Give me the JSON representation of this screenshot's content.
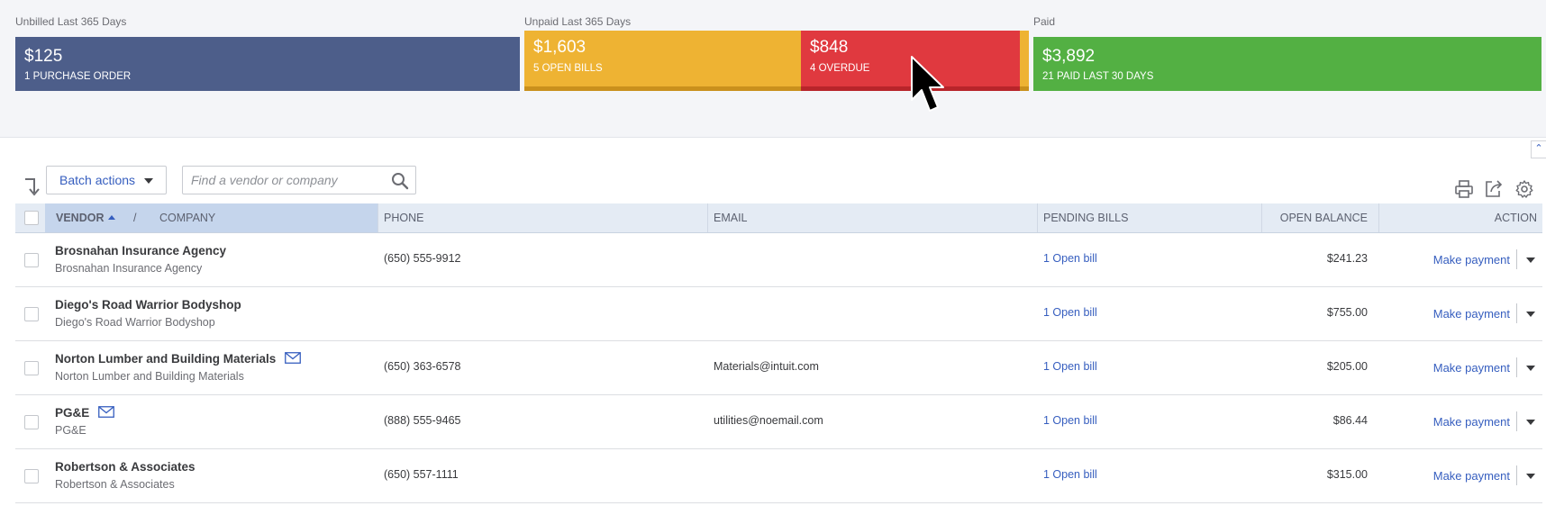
{
  "money_bar": {
    "unbilled": {
      "label": "Unbilled Last 365 Days",
      "amount": "$125",
      "sub": "1 PURCHASE ORDER"
    },
    "unpaid": {
      "label": "Unpaid Last 365 Days",
      "open": {
        "amount": "$1,603",
        "sub": "5 OPEN BILLS"
      },
      "overdue": {
        "amount": "$848",
        "sub": "4 OVERDUE"
      }
    },
    "paid": {
      "label": "Paid",
      "amount": "$3,892",
      "sub": "21 PAID LAST 30 DAYS"
    },
    "colors": {
      "unbilled": "#4d5e8a",
      "open": "#eeb333",
      "overdue": "#e0393f",
      "paid": "#53b043"
    }
  },
  "toolbar": {
    "batch_actions_label": "Batch actions",
    "search_placeholder": "Find a vendor or company"
  },
  "table": {
    "headers": {
      "vendor": "VENDOR",
      "slash": "/",
      "company": "COMPANY",
      "phone": "PHONE",
      "email": "EMAIL",
      "pending_bills": "PENDING BILLS",
      "open_balance": "OPEN BALANCE",
      "action": "ACTION"
    },
    "rows": [
      {
        "vendor": "Brosnahan Insurance Agency",
        "company": "Brosnahan Insurance Agency",
        "phone": "(650) 555-9912",
        "email": "",
        "pending": "1 Open bill",
        "balance": "$241.23",
        "action": "Make payment",
        "has_email_icon": false
      },
      {
        "vendor": "Diego's Road Warrior Bodyshop",
        "company": "Diego's Road Warrior Bodyshop",
        "phone": "",
        "email": "",
        "pending": "1 Open bill",
        "balance": "$755.00",
        "action": "Make payment",
        "has_email_icon": false
      },
      {
        "vendor": "Norton Lumber and Building Materials",
        "company": "Norton Lumber and Building Materials",
        "phone": "(650) 363-6578",
        "email": "Materials@intuit.com",
        "pending": "1 Open bill",
        "balance": "$205.00",
        "action": "Make payment",
        "has_email_icon": true
      },
      {
        "vendor": "PG&E",
        "company": "PG&E",
        "phone": "(888) 555-9465",
        "email": "utilities@noemail.com",
        "pending": "1 Open bill",
        "balance": "$86.44",
        "action": "Make payment",
        "has_email_icon": true
      },
      {
        "vendor": "Robertson & Associates",
        "company": "Robertson & Associates",
        "phone": "(650) 557-1111",
        "email": "",
        "pending": "1 Open bill",
        "balance": "$315.00",
        "action": "Make payment",
        "has_email_icon": false
      }
    ]
  },
  "icons": [
    "sort-icon",
    "search-icon",
    "print-icon",
    "export-icon",
    "gear-icon",
    "mail-icon",
    "chevron-down-icon",
    "chevron-up-icon",
    "mouse-cursor-icon"
  ]
}
